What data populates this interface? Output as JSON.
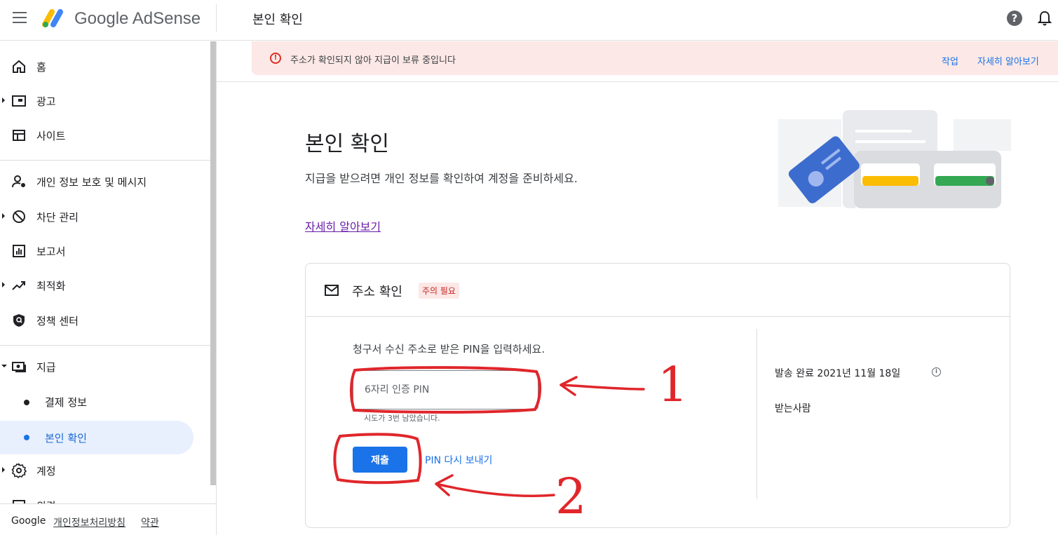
{
  "topbar": {
    "brand_google": "Google",
    "brand_adsense": "AdSense",
    "page_title": "본인 확인"
  },
  "sidebar": {
    "items": [
      {
        "label": "홈",
        "icon": "home-icon"
      },
      {
        "label": "광고",
        "icon": "ads-icon"
      },
      {
        "label": "사이트",
        "icon": "sites-icon"
      },
      {
        "label": "개인 정보 보호 및 메시지",
        "icon": "privacy-icon"
      },
      {
        "label": "차단 관리",
        "icon": "block-icon"
      },
      {
        "label": "보고서",
        "icon": "reports-icon"
      },
      {
        "label": "최적화",
        "icon": "optimization-icon"
      },
      {
        "label": "정책 센터",
        "icon": "policy-icon"
      },
      {
        "label": "지급",
        "icon": "payments-icon"
      },
      {
        "label": "결제 정보"
      },
      {
        "label": "본인 확인"
      },
      {
        "label": "계정",
        "icon": "gear-icon"
      },
      {
        "label": "의견",
        "icon": "feedback-icon"
      }
    ],
    "footer": {
      "google": "Google",
      "privacy": "개인정보처리방침",
      "terms": "약관"
    }
  },
  "alert": {
    "message": "주소가 확인되지 않아 지급이 보류 중입니다",
    "action": "작업",
    "learn_more": "자세히 알아보기"
  },
  "main": {
    "title": "본인 확인",
    "description": "지급을 받으려면 개인 정보를 확인하여 계정을 준비하세요.",
    "learn_more": "자세히 알아보기"
  },
  "card": {
    "title": "주소 확인",
    "badge": "주의 필요",
    "prompt": "청구서 수신 주소로 받은 PIN을 입력하세요.",
    "pin_placeholder": "6자리 인증 PIN",
    "attempts": "시도가 3번 남았습니다.",
    "submit": "제출",
    "resend": "PIN 다시 보내기",
    "sent_label": "발송 완료  2021년 11월 18일",
    "recipient_label": "받는사람"
  },
  "annotations": {
    "one": "1",
    "two": "2",
    "color": "#e0262b"
  }
}
